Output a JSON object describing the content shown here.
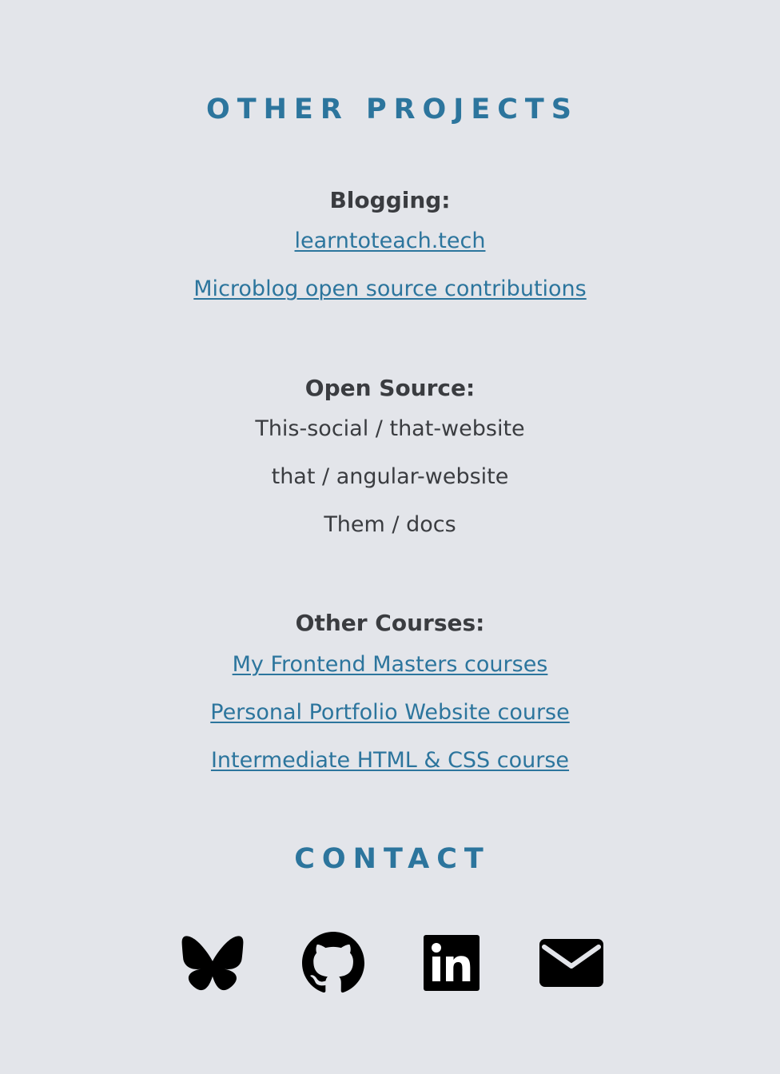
{
  "other_projects": {
    "heading": "OTHER PROJECTS",
    "blogging": {
      "title": "Blogging:",
      "links": [
        "learntoteach.tech",
        "Microblog open source contributions"
      ]
    },
    "open_source": {
      "title": "Open Source:",
      "items": [
        "This-social / that-website",
        "that / angular-website",
        "Them / docs"
      ]
    },
    "other_courses": {
      "title": "Other Courses:",
      "links": [
        "My Frontend Masters courses",
        "Personal Portfolio Website course",
        "Intermediate HTML & CSS course"
      ]
    }
  },
  "contact": {
    "heading": "CONTACT",
    "icons": [
      "bluesky-icon",
      "github-icon",
      "linkedin-icon",
      "email-icon"
    ]
  },
  "colors": {
    "background": "#e3e5ea",
    "accent": "#2c759d",
    "text": "#3a3c40",
    "icon": "#000000"
  }
}
